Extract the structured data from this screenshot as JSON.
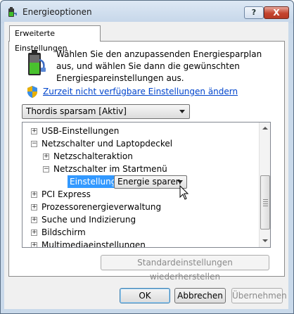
{
  "window": {
    "title": "Energieoptionen",
    "help_label": "?",
    "close_label": "X"
  },
  "tab": {
    "label": "Erweiterte Einstellungen"
  },
  "intro": {
    "text": "Wählen Sie den anzupassenden Energiesparplan aus, und wählen Sie dann die gewünschten Energiespareinstellungen aus."
  },
  "admin_link": {
    "label": "Zurzeit nicht verfügbare Einstellungen ändern"
  },
  "plan_select": {
    "value": "Thordis sparsam [Aktiv]"
  },
  "tree": {
    "items": [
      {
        "label": "USB-Einstellungen",
        "expander": "+"
      },
      {
        "label": "Netzschalter und Laptopdeckel",
        "expander": "−"
      },
      {
        "label": "Netzschalteraktion",
        "expander": "+"
      },
      {
        "label": "Netzschalter im Startmenü",
        "expander": "−"
      },
      {
        "label": "PCI Express",
        "expander": "+"
      },
      {
        "label": "Prozessorenergieverwaltung",
        "expander": "+"
      },
      {
        "label": "Suche und Indizierung",
        "expander": "+"
      },
      {
        "label": "Bildschirm",
        "expander": "+"
      },
      {
        "label": "Multimediaeinstellungen",
        "expander": "+"
      }
    ],
    "setting": {
      "label": "Einstellung:",
      "value": "Energie sparen"
    }
  },
  "buttons": {
    "restore": "Standardeinstellungen wiederherstellen",
    "ok": "OK",
    "cancel": "Abbrechen",
    "apply": "Übernehmen"
  },
  "colors": {
    "selection": "#3399ff",
    "link": "#0044cc",
    "window_frame": "#c9d9ea"
  },
  "icons": {
    "window": "power-options-icon",
    "intro": "battery-plug-icon",
    "link": "uac-shield-icon"
  }
}
